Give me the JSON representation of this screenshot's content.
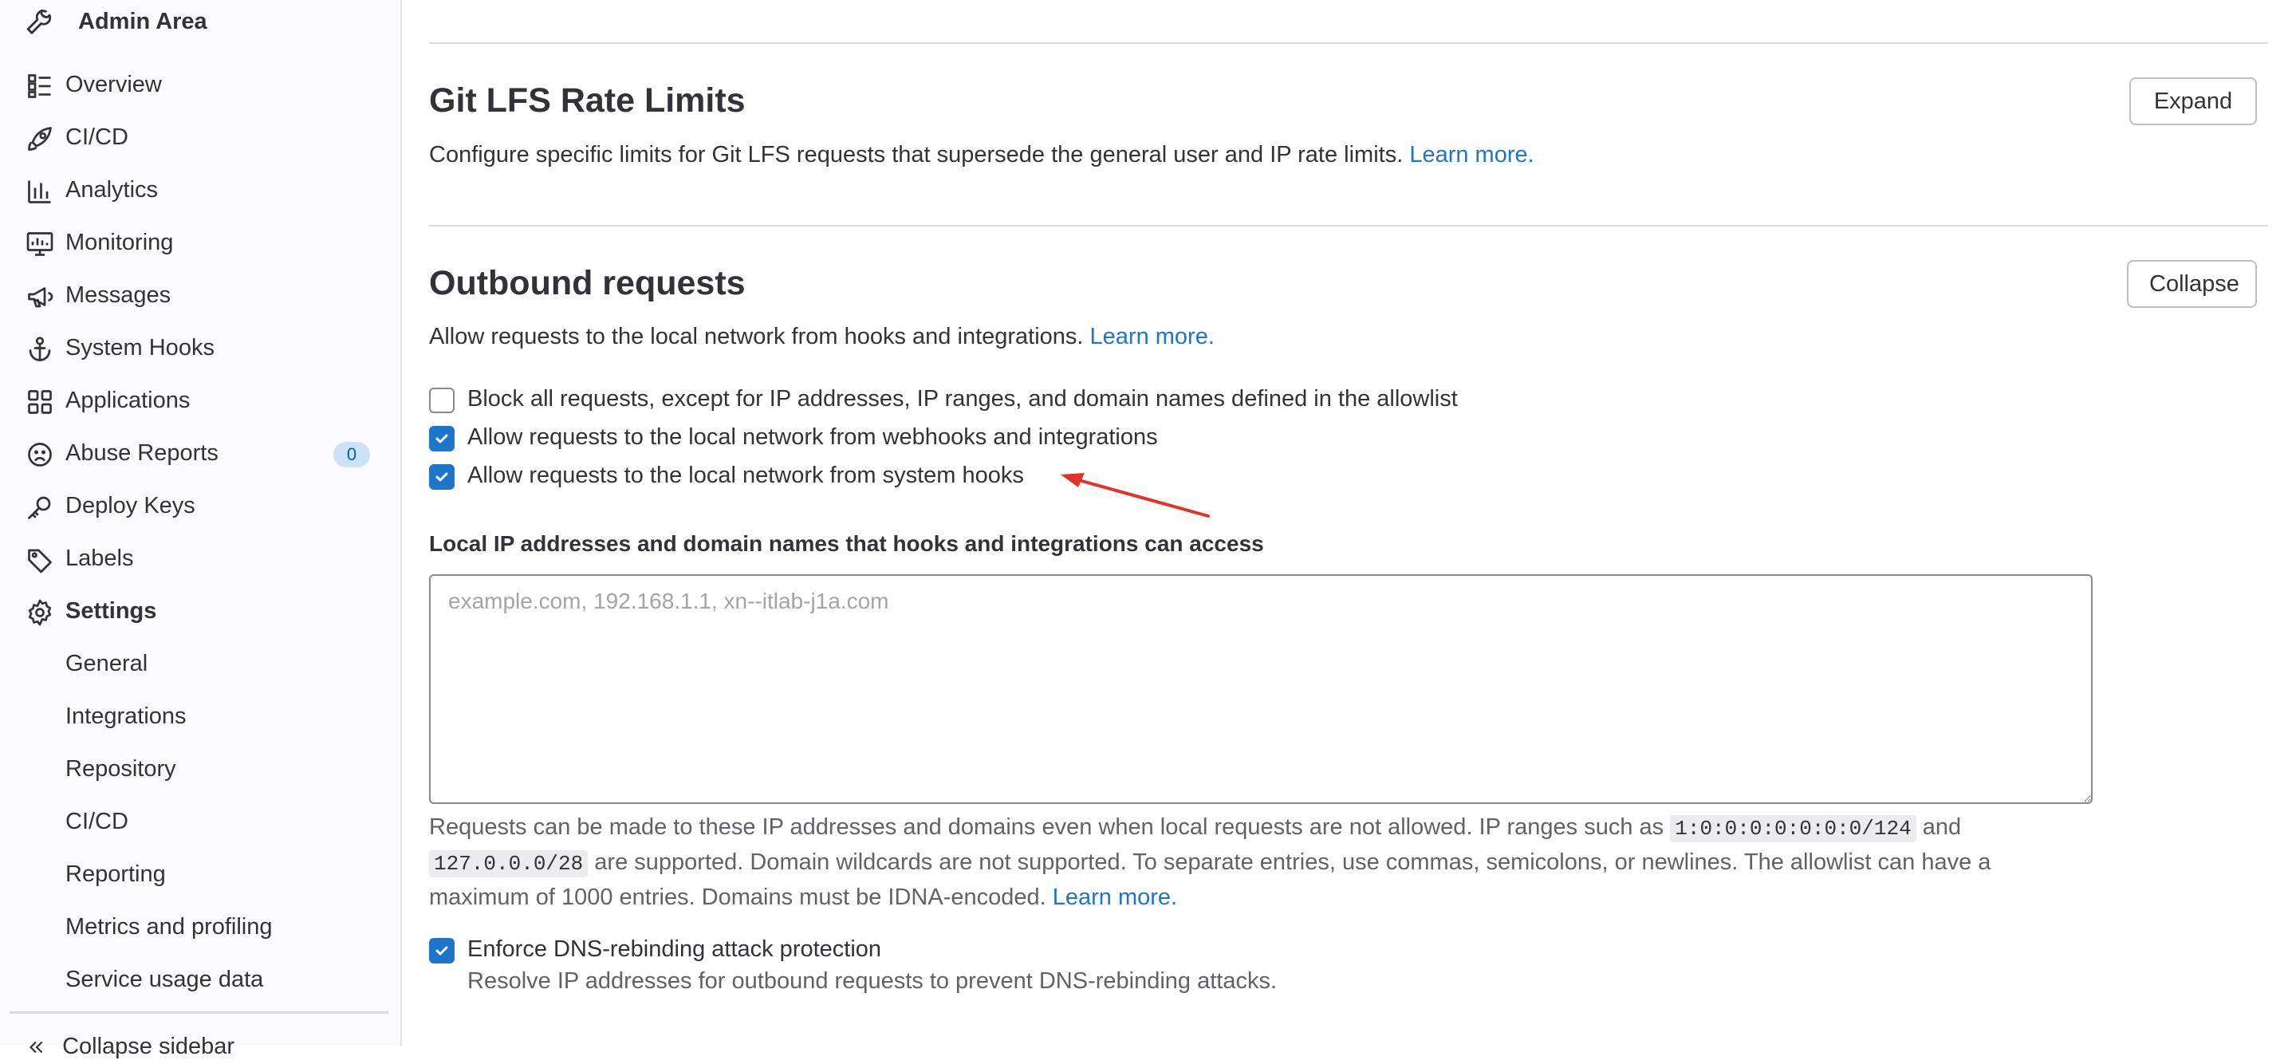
{
  "sidebar": {
    "header": {
      "title": "Admin Area",
      "icon": "wrench-icon"
    },
    "items": [
      {
        "label": "Overview",
        "icon": "overview-icon"
      },
      {
        "label": "CI/CD",
        "icon": "rocket-icon"
      },
      {
        "label": "Analytics",
        "icon": "chart-icon"
      },
      {
        "label": "Monitoring",
        "icon": "monitor-icon"
      },
      {
        "label": "Messages",
        "icon": "megaphone-icon"
      },
      {
        "label": "System Hooks",
        "icon": "anchor-icon"
      },
      {
        "label": "Applications",
        "icon": "applications-icon"
      },
      {
        "label": "Abuse Reports",
        "icon": "abuse-icon",
        "badge": "0"
      },
      {
        "label": "Deploy Keys",
        "icon": "key-icon"
      },
      {
        "label": "Labels",
        "icon": "label-icon"
      },
      {
        "label": "Settings",
        "icon": "settings-icon",
        "active": true
      }
    ],
    "settings_sub": [
      "General",
      "Integrations",
      "Repository",
      "CI/CD",
      "Reporting",
      "Metrics and profiling",
      "Service usage data"
    ],
    "collapse_label": "Collapse sidebar"
  },
  "git_lfs": {
    "title": "Git LFS Rate Limits",
    "description": "Configure specific limits for Git LFS requests that supersede the general user and IP rate limits.",
    "learn_more": "Learn more.",
    "button": "Expand"
  },
  "outbound": {
    "title": "Outbound requests",
    "description": "Allow requests to the local network from hooks and integrations.",
    "learn_more": "Learn more.",
    "button": "Collapse",
    "checkboxes": [
      {
        "label": "Block all requests, except for IP addresses, IP ranges, and domain names defined in the allowlist",
        "checked": false
      },
      {
        "label": "Allow requests to the local network from webhooks and integrations",
        "checked": true
      },
      {
        "label": "Allow requests to the local network from system hooks",
        "checked": true
      }
    ],
    "allowlist": {
      "label": "Local IP addresses and domain names that hooks and integrations can access",
      "placeholder": "example.com, 192.168.1.1, xn--itlab-j1a.com",
      "value": "",
      "help_part1": "Requests can be made to these IP addresses and domains even when local requests are not allowed. IP ranges such as",
      "code1": "1:0:0:0:0:0:0:0/124",
      "help_part2": "and",
      "code2": "127.0.0.0/28",
      "help_part3": "are supported. Domain wildcards are not supported. To separate entries, use commas, semicolons, or newlines. The allowlist can have a maximum of 1000 entries. Domains must be IDNA-encoded.",
      "learn_more": "Learn more."
    },
    "dns": {
      "label": "Enforce DNS-rebinding attack protection",
      "checked": true,
      "help": "Resolve IP addresses for outbound requests to prevent DNS-rebinding attacks."
    }
  },
  "colors": {
    "accent": "#1f75cb",
    "annotation_arrow": "#e3322b"
  }
}
